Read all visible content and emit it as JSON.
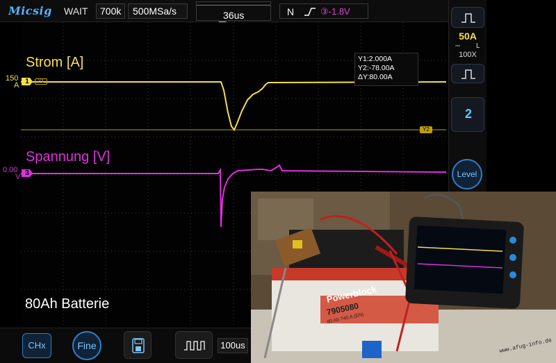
{
  "app": {
    "brand": "Micsig",
    "run_state": "WAIT",
    "memory_depth": "700k",
    "sample_rate": "500MSa/s"
  },
  "timebase": {
    "trigger_position": "36us",
    "per_div": "100us"
  },
  "trigger": {
    "mode": "N",
    "source": "③-1.8V"
  },
  "channels": [
    {
      "label": "Strom [A]",
      "marker": "1",
      "scale_top": "150",
      "scale_unit": "A",
      "color": "#f5e04a"
    },
    {
      "label": "Spannung [V]",
      "marker": "3",
      "scale_top": "0.00",
      "scale_unit": "V",
      "color": "#e030e0"
    }
  ],
  "cursors": {
    "y1": "Y1:2.000A",
    "y2": "Y2:-78.00A",
    "dy": "ΔY:80.00A",
    "y1_tag": "Y1",
    "y2_tag": "Y2"
  },
  "right_panel": {
    "vdiv": "50A",
    "probe": "100X",
    "coupling_short": "L",
    "channel_button": "2",
    "level_button": "Level"
  },
  "bottom": {
    "chx": "CHx",
    "fine": "Fine"
  },
  "caption": "80Ah Batterie",
  "photo": {
    "battery_brand": "Powerblock",
    "battery_model": "7905080",
    "battery_capacity": "80 Ah 740 A (EN)",
    "watermark": "www.afug-info.de"
  },
  "colors": {
    "ch1": "#f5e04a",
    "ch3": "#e030e0",
    "accent": "#2f7fc8"
  }
}
